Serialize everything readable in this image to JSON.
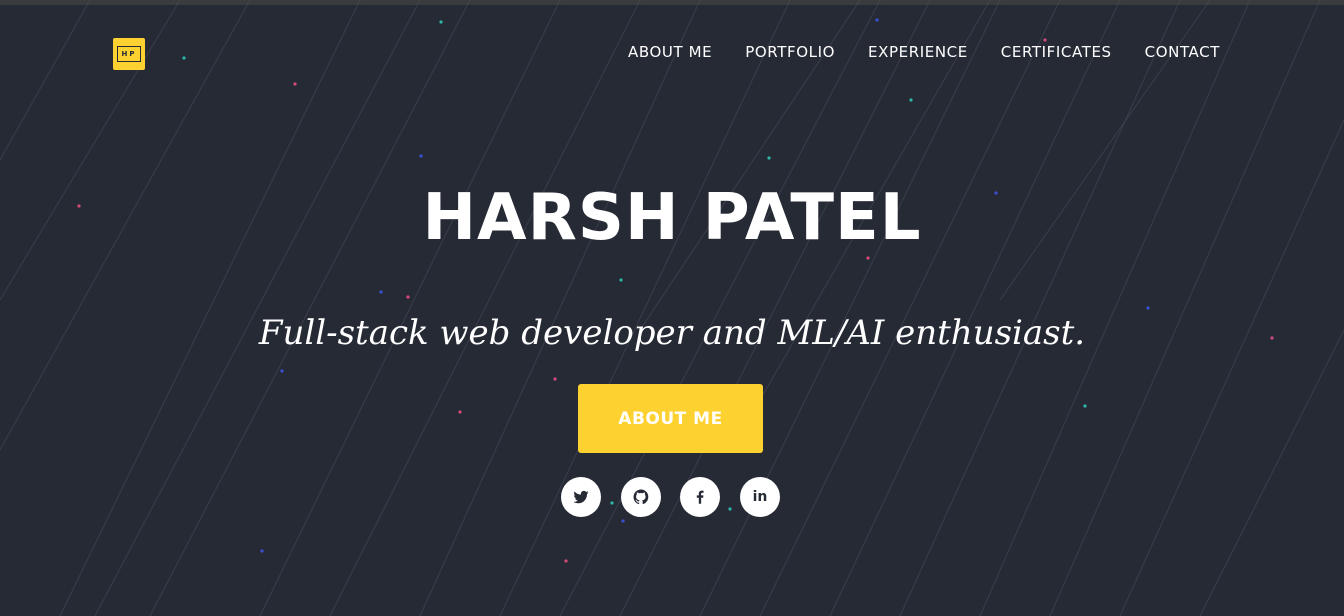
{
  "header": {
    "logo_text": "HP",
    "nav": [
      {
        "label": "ABOUT ME"
      },
      {
        "label": "PORTFOLIO"
      },
      {
        "label": "EXPERIENCE"
      },
      {
        "label": "CERTIFICATES"
      },
      {
        "label": "CONTACT"
      }
    ]
  },
  "hero": {
    "title": "HARSH PATEL",
    "subtitle": "Full-stack web developer and ML/AI enthusiast.",
    "cta_label": "ABOUT ME"
  },
  "social": [
    {
      "icon": "twitter-icon"
    },
    {
      "icon": "github-icon"
    },
    {
      "icon": "facebook-icon"
    },
    {
      "icon": "linkedin-icon",
      "text": "in"
    }
  ],
  "colors": {
    "background": "#262a35",
    "accent": "#fdd130",
    "text": "#ffffff",
    "streak": "#4a4f5c",
    "dot_pink": "#d64a7a",
    "dot_teal": "#2bb6a8",
    "dot_blue": "#3c4fd0"
  }
}
